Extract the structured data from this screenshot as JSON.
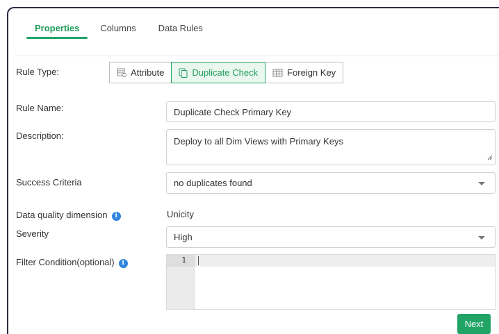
{
  "tabs": [
    {
      "label": "Properties",
      "active": true
    },
    {
      "label": "Columns",
      "active": false
    },
    {
      "label": "Data Rules",
      "active": false
    }
  ],
  "form": {
    "rule_type": {
      "label": "Rule Type:",
      "options": [
        {
          "label": "Attribute",
          "icon": "attribute-table-icon",
          "selected": false
        },
        {
          "label": "Duplicate Check",
          "icon": "duplicate-document-icon",
          "selected": true
        },
        {
          "label": "Foreign Key",
          "icon": "foreign-key-table-icon",
          "selected": false
        }
      ]
    },
    "rule_name": {
      "label": "Rule Name:",
      "value": "Duplicate Check Primary Key"
    },
    "description": {
      "label": "Description:",
      "value": "Deploy to all Dim Views with Primary Keys"
    },
    "success_criteria": {
      "label": "Success Criteria",
      "value": "no duplicates found"
    },
    "dq_dimension": {
      "label": "Data quality dimension",
      "value": "Unicity",
      "icon": "info-icon"
    },
    "severity": {
      "label": "Severity",
      "value": "High"
    },
    "filter_condition": {
      "label": "Filter Condition(optional)",
      "icon": "info-icon",
      "line_numbers": [
        "1"
      ],
      "value": ""
    }
  },
  "actions": {
    "next_label": "Next"
  },
  "colors": {
    "accent": "#21a366",
    "accent_text": "#1e9d5b",
    "accent_bg": "#e9f7ef",
    "info": "#2e86de",
    "frame": "#2f2a46"
  }
}
